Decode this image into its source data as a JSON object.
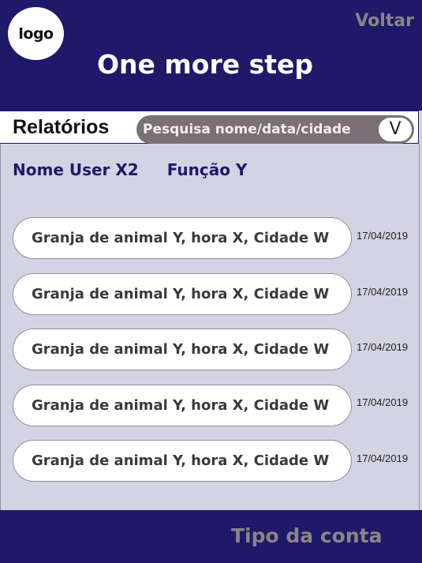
{
  "header": {
    "logo_text": "logo",
    "back_label": "Voltar",
    "title": "One more step"
  },
  "subbar": {
    "title": "Relatórios",
    "search_placeholder": "Pesquisa nome/data/cidade",
    "search_button": "V"
  },
  "user": {
    "name": "Nome User X2",
    "role": "Função Y"
  },
  "reports": [
    {
      "label": "Granja de animal Y, hora X, Cidade W",
      "date": "17/04/2019"
    },
    {
      "label": "Granja de animal Y, hora X, Cidade W",
      "date": "17/04/2019"
    },
    {
      "label": "Granja de animal Y, hora X, Cidade W",
      "date": "17/04/2019"
    },
    {
      "label": "Granja de animal Y, hora  X, Cidade W",
      "date": "17/04/2019"
    },
    {
      "label": "Granja de animal Y, hora  X, Cidade W",
      "date": "17/04/2019"
    }
  ],
  "footer": {
    "account_type_label": "Tipo da conta"
  },
  "colors": {
    "primary": "#1e1968",
    "background": "#d3d3e3",
    "muted": "#8b8489"
  }
}
